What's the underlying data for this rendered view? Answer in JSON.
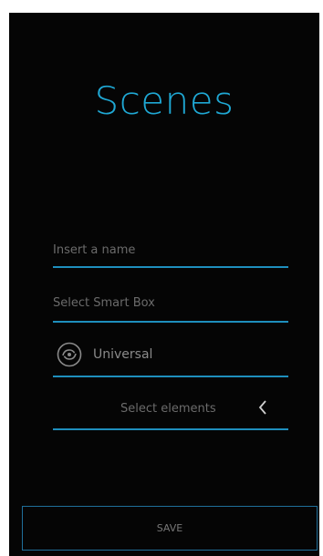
{
  "title": "Scenes",
  "form": {
    "name_placeholder": "Insert a name",
    "smartbox_placeholder": "Select Smart Box",
    "type_value": "Universal",
    "type_icon": "universal-remote-icon",
    "elements_label": "Select elements",
    "elements_icon": "chevron-left-icon"
  },
  "actions": {
    "save_label": "SAVE"
  },
  "colors": {
    "accent": "#1fa8d4",
    "background": "#050505",
    "text_muted": "#6b6b6b",
    "button_border": "#1f6f9a"
  }
}
